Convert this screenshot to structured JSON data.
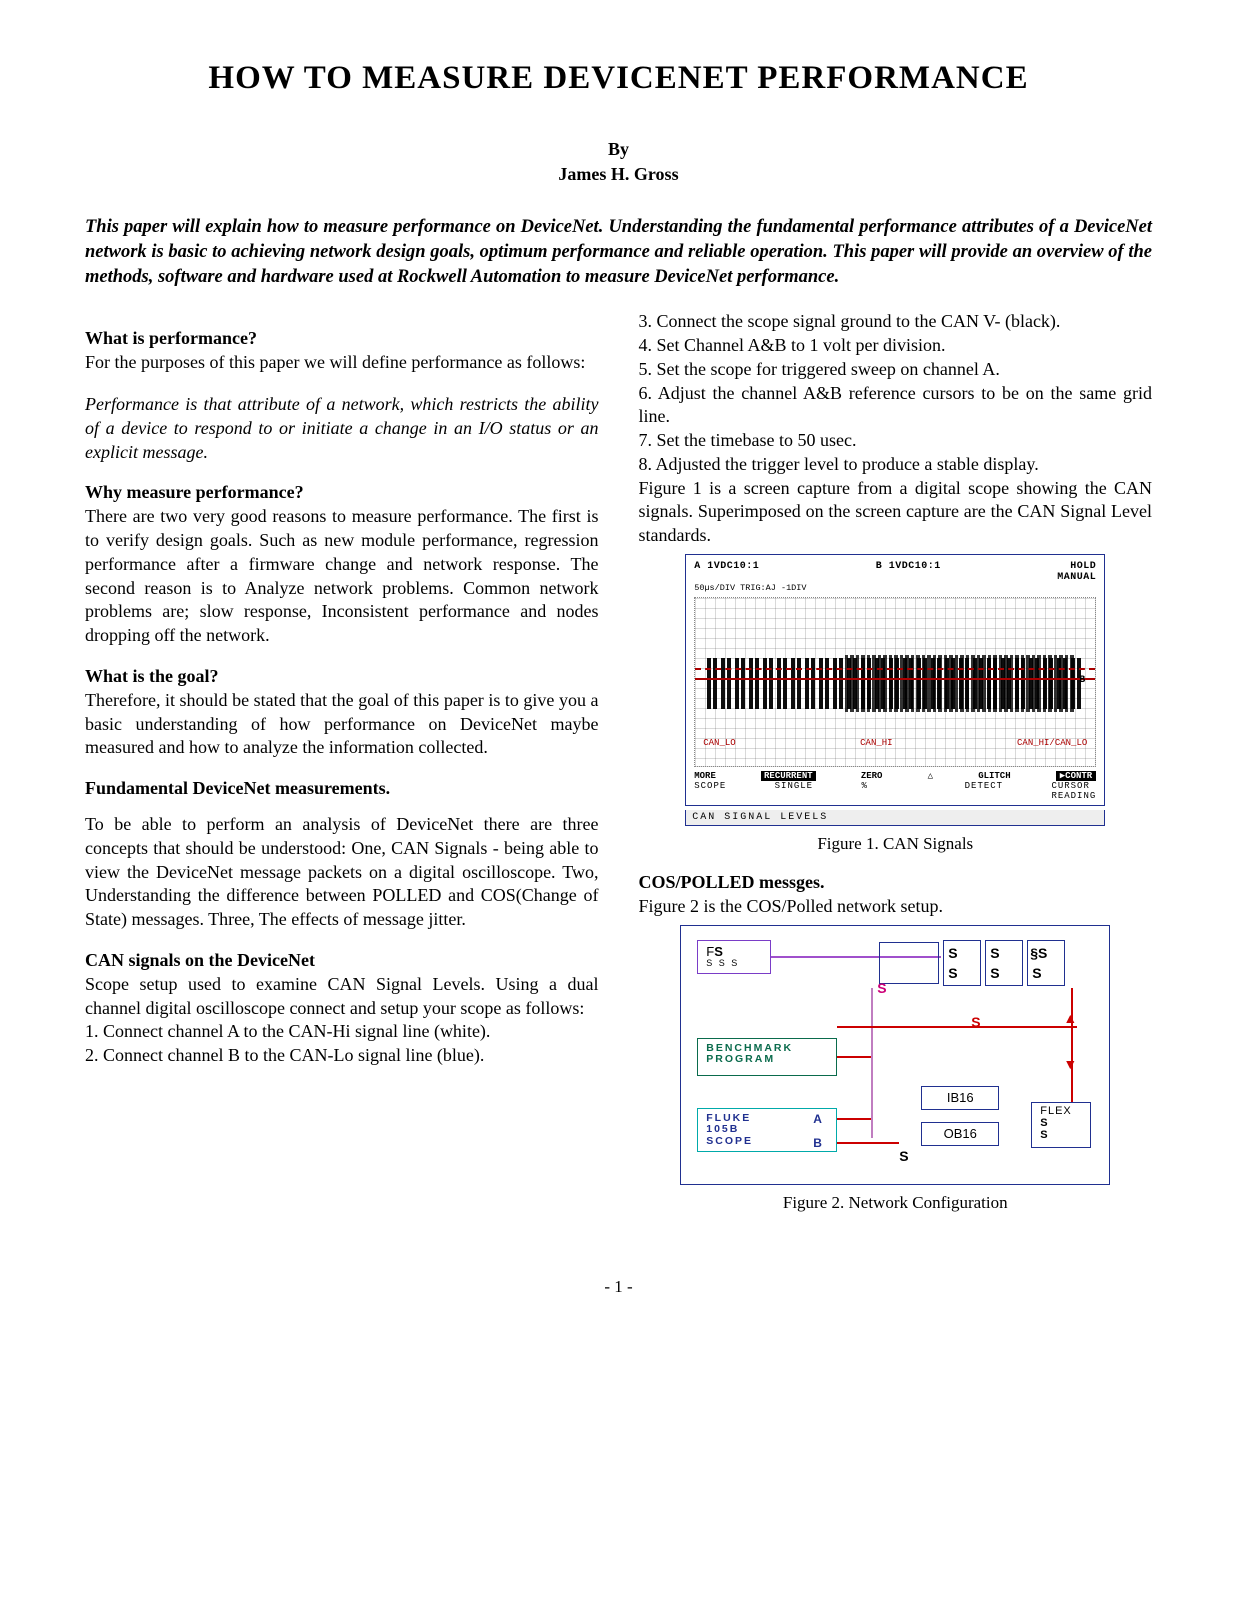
{
  "title": "HOW TO MEASURE DEVICENET PERFORMANCE",
  "byline": "By",
  "author": "James H. Gross",
  "abstract": "This paper will explain how to measure performance on DeviceNet. Understanding the fundamental performance attributes of a DeviceNet network is basic to achieving network design goals, optimum performance and reliable operation. This paper will provide an overview of the methods, software and hardware used at Rockwell Automation to measure DeviceNet performance.",
  "left": {
    "h1": "What is performance?",
    "p1": "For the purposes of this paper we will define performance as follows:",
    "def": "Performance is that attribute of a network, which restricts the ability of a device to respond to or initiate a change in an I/O status or an explicit message.",
    "h2": "Why measure performance?",
    "p2": "There are two very good reasons to measure performance. The first is to verify design goals. Such as new module performance, regression performance after a firmware change and  network response. The second reason is to Analyze network problems. Common network problems are; slow response, Inconsistent performance and nodes dropping off the network.",
    "h3": "What is the goal?",
    "p3": "Therefore, it should be stated that the goal of this paper is to give you a basic understanding of how performance on DeviceNet maybe measured and how to analyze the information collected.",
    "h4": "Fundamental DeviceNet measurements.",
    "p4": "To be able to perform an analysis of DeviceNet there are three concepts that should be understood: One, CAN Signals - being able to view the DeviceNet message packets on a digital oscilloscope. Two, Understanding the difference between POLLED and COS(Change of State) messages. Three, The effects of message jitter.",
    "h5": "CAN signals on the DeviceNet",
    "p5": "Scope setup used to examine CAN Signal Levels. Using a dual channel digital oscilloscope connect and setup your scope as follows:",
    "s1": "1. Connect channel A to the CAN-Hi signal line (white).",
    "s2": "2. Connect channel B to the CAN-Lo signal line (blue)."
  },
  "right": {
    "s3": "3. Connect the scope signal ground to the CAN V- (black).",
    "s4": "4. Set Channel A&B  to 1 volt per division.",
    "s5": "5. Set the scope for triggered sweep on channel A.",
    "s6": "6. Adjust the channel A&B reference cursors to be on the same grid line.",
    "s7": "7. Set the timebase to 50 usec.",
    "s8": "8. Adjusted the trigger level to produce a stable display.",
    "p6": "Figure 1 is a screen capture from a digital scope showing the CAN signals. Superimposed on the screen capture are the CAN Signal Level standards.",
    "fig1": {
      "top_left_a": "1VDC10:1",
      "top_left_sub": "50µs/DIV TRIG:AJ -1DIV",
      "top_mid": "1VDC10:1",
      "top_right": "HOLD",
      "top_right2": "MANUAL",
      "can_lo": "CAN_LO",
      "can_hi": "CAN_HI",
      "can_diff": "CAN_HI/CAN_LO",
      "b": "B",
      "bot_more": "MORE",
      "bot_scope": "SCOPE",
      "bot_recur": "RECURRENT",
      "bot_single": "SINGLE",
      "bot_zero": "ZERO",
      "bot_pct": "%",
      "bot_tri": "△",
      "bot_glitch": "GLITCH",
      "bot_detect": "DETECT",
      "bot_contr": "▶CONTR",
      "bot_cursor": "CURSOR",
      "bot_reading": "READING",
      "bottom_bar": "CAN  SIGNAL  LEVELS",
      "caption": "Figure 1. CAN Signals"
    },
    "h6": "COS/POLLED messges.",
    "p7": "Figure 2 is the COS/Polled network setup.",
    "fig2": {
      "cpu_top": "F",
      "cpu_bot": "S S S",
      "benchmark_l1": "BENCHMARK",
      "benchmark_l2": "PROGRAM",
      "fluke_l1": "FLUKE",
      "fluke_l2": "105B",
      "fluke_l3": "SCOPE",
      "a": "A",
      "b": "B",
      "ib16": "IB16",
      "ob16": "OB16",
      "flex": "FLEX",
      "s": "S",
      "caption": "Figure 2. Network Configuration"
    }
  },
  "page_number": "- 1 -"
}
